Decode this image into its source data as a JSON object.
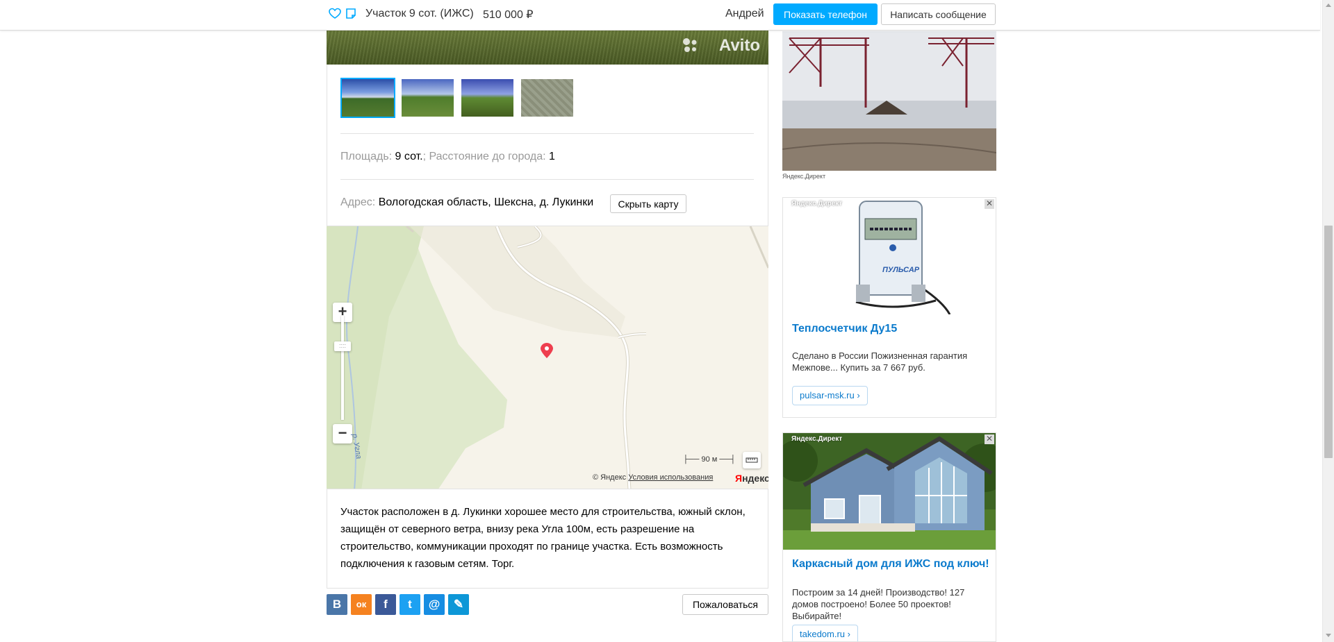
{
  "header": {
    "favorite_icon": "heart-icon",
    "note_icon": "note-icon",
    "title": "Участок 9 сот. (ИЖС)",
    "price": "510 000  ₽",
    "user_name": "Андрей",
    "show_phone": "Показать телефон",
    "write_message": "Написать сообщение"
  },
  "photo": {
    "watermark": "Avito"
  },
  "thumbnails": [
    {
      "name": "photo-1",
      "active": true
    },
    {
      "name": "photo-2",
      "active": false
    },
    {
      "name": "photo-3",
      "active": false
    },
    {
      "name": "photo-4",
      "active": false
    }
  ],
  "params": {
    "area_label": "Площадь: ",
    "area_value": "9 сот.",
    "sep": "; ",
    "distance_label": "Расстояние до города: ",
    "distance_value": "1"
  },
  "address": {
    "label": "Адрес: ",
    "value": "Вологодская область, Шексна, д. Лукинки",
    "hide_map": "Скрыть карту"
  },
  "map": {
    "zoom_in": "+",
    "zoom_out": "−",
    "handle": "::::",
    "scale": "90 м",
    "copyright": "© Яндекс",
    "terms": "Условия использования",
    "logo_ya": "Я",
    "logo_rest": "ндекс",
    "river_label": "р. Угла"
  },
  "description": "Участок расположен в д. Лукинки хорошее место для строительства, южный склон, защищён от северного ветра, внизу река Угла 100м, есть разрешение на строительство, коммуникации проходят по границе участка. Есть возможность подключения к газовым сетям. Торг.",
  "share": {
    "vk": "В",
    "ok": "ок",
    "fb": "f",
    "tw": "t",
    "mail": "@",
    "lj": "✎",
    "report": "Пожаловаться"
  },
  "ads": {
    "top_caption": "Яндекс.Директ",
    "ad2": {
      "label": "Яндекс.Директ",
      "close": "✕",
      "title": "Теплосчетчик Ду15",
      "text": "Сделано в России Пожизненная гарантия Межпове... Купить за 7 667 руб.",
      "link": "pulsar-msk.ru ›",
      "device_text": "ПУЛЬСАР"
    },
    "ad3": {
      "label": "Яндекс.Директ",
      "close": "✕",
      "title": "Каркасный дом для ИЖС под ключ!",
      "text": "Построим за 14 дней! Производство! 127 домов построено! Более 50 проектов! Выбирайте!",
      "link": "takedom.ru ›"
    }
  },
  "colors": {
    "accent": "#00aaff",
    "link": "#0a7acc",
    "vk": "#4a76a8",
    "ok": "#f58220",
    "fb": "#3b5998",
    "tw": "#1da1f2",
    "mail": "#168de2",
    "lj": "#0d97d7"
  }
}
